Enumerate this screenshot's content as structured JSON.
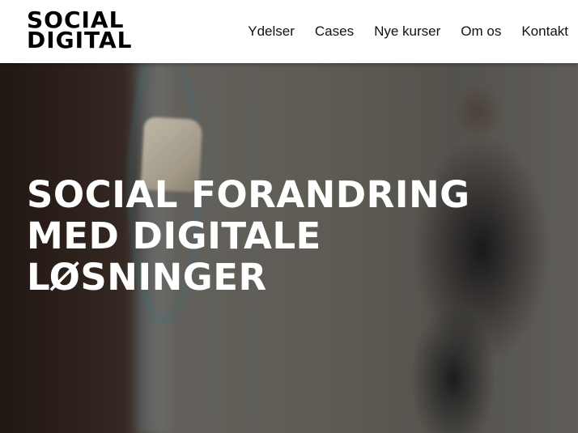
{
  "header": {
    "logo": {
      "line1": "SOCIAL",
      "line2": "DIGITAL"
    },
    "nav": [
      {
        "label": "Ydelser"
      },
      {
        "label": "Cases"
      },
      {
        "label": "Nye kurser"
      },
      {
        "label": "Om os"
      },
      {
        "label": "Kontakt"
      }
    ]
  },
  "hero": {
    "title_lines": [
      "SOCIAL FORANDRING",
      "MED DIGITALE",
      "LØSNINGER"
    ]
  },
  "colors": {
    "header_bg": "#ffffff",
    "text": "#000000",
    "hero_text": "#ffffff"
  }
}
